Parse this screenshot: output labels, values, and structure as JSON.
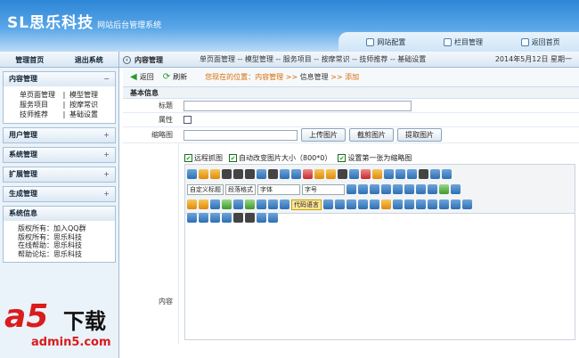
{
  "header": {
    "logo": "SL思乐科技",
    "subtitle": "网站后台管理系统",
    "links": [
      {
        "label": "网站配置",
        "icon": "gear-icon"
      },
      {
        "label": "栏目管理",
        "icon": "folder-icon"
      },
      {
        "label": "返回首页",
        "icon": "home-icon"
      }
    ]
  },
  "navbar": {
    "home": "管理首页",
    "logout": "退出系统",
    "crumb": "内容管理",
    "topnav": "单页面管理 -- 模型管理 -- 服务项目 -- 按摩常识 -- 技师推荐 -- 基础设置",
    "date": "2014年5月12日 星期一"
  },
  "sidebar": {
    "content": {
      "title": "内容管理",
      "sign": "−",
      "items": [
        [
          "单页面管理",
          "模型管理"
        ],
        [
          "服务项目",
          "按摩常识"
        ],
        [
          "技师推荐",
          "基础设置"
        ]
      ]
    },
    "groups": [
      {
        "title": "用户管理",
        "sign": "+"
      },
      {
        "title": "系统管理",
        "sign": "+"
      },
      {
        "title": "扩展管理",
        "sign": "+"
      },
      {
        "title": "生成管理",
        "sign": "+"
      }
    ],
    "sysinfo": {
      "title": "系统信息",
      "lines": [
        "版权所有：加入QQ群",
        "版权所有：思乐科技",
        "在线帮助：思乐科技",
        "帮助论坛：思乐科技"
      ]
    }
  },
  "toolbar": {
    "back": "返回",
    "refresh": "刷新",
    "loc_prefix": "您现在的位置：",
    "loc1": "内容管理",
    "sep": ">>",
    "loc2": "信息管理",
    "loc3": "添加"
  },
  "form": {
    "section": "基本信息",
    "title_label": "标题",
    "attr_label": "属性",
    "thumb_label": "缩略图",
    "upload_btn": "上传图片",
    "crop_btn": "截剪图片",
    "fetch_btn": "提取图片",
    "content_label": "内容",
    "opt1": "远程抓图",
    "opt2": "自动改变图片大小（800*0）",
    "opt3": "设置第一张为缩略图",
    "selects": {
      "title": "自定义标题",
      "para": "段落格式",
      "font": "字体",
      "size": "字号",
      "code": "代码语言"
    }
  },
  "watermark": {
    "brand": "a5",
    "dl": "下载",
    "site": "admin5.com"
  }
}
